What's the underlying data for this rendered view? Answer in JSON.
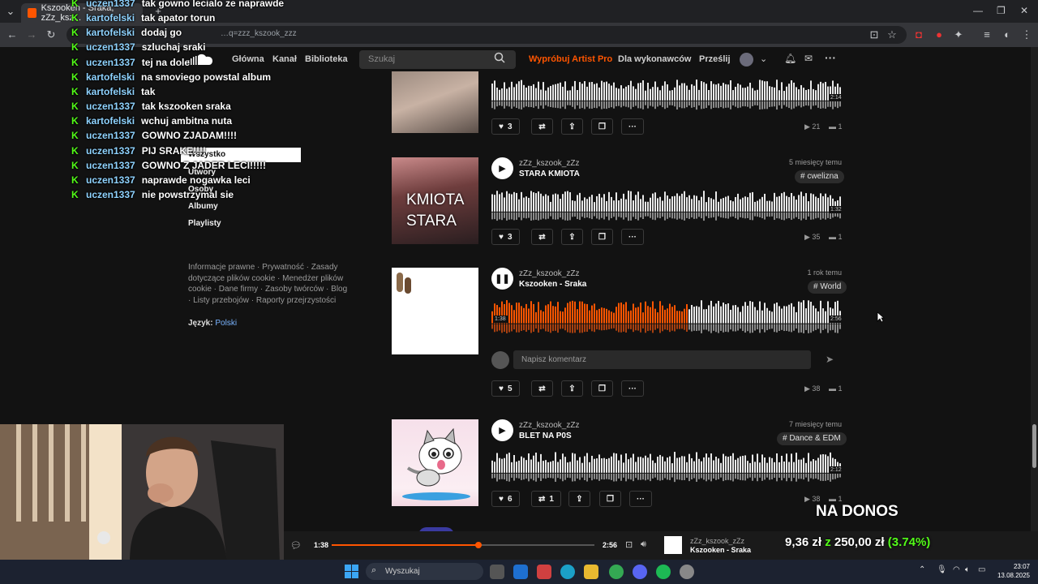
{
  "browser": {
    "tab_title": "Kszooken - Sraka, zZz_ksz...",
    "url": "…q=zzz_kszook_zzz"
  },
  "header": {
    "nav": [
      "Główna",
      "Kanał",
      "Biblioteka"
    ],
    "search_placeholder": "Szukaj",
    "artist_pro": "Wypróbuj Artist Pro",
    "for_artists": "Dla wykonawców",
    "upload": "Prześlij"
  },
  "sidebar": {
    "filters": [
      "Wszystko",
      "Utwory",
      "Osoby",
      "Albumy",
      "Playlisty"
    ],
    "legal": "Informacje prawne · Prywatność · Zasady dotyczące plików cookie · Menedżer plików cookie · Dane firmy · Zasoby twórców · Blog · Listy przebojów · Raporty przejrzystości",
    "lang_label": "Język:",
    "lang_value": "Polski"
  },
  "chat": [
    {
      "user": "uczen1337",
      "msg": "tak gowno lecialo ze naprawde"
    },
    {
      "user": "kartofelski",
      "msg": "tak apator torun"
    },
    {
      "user": "kartofelski",
      "msg": "dodaj go"
    },
    {
      "user": "uczen1337",
      "msg": "szluchaj sraki"
    },
    {
      "user": "uczen1337",
      "msg": "tej na dole"
    },
    {
      "user": "kartofelski",
      "msg": "na smoviego powstal album"
    },
    {
      "user": "kartofelski",
      "msg": "tak"
    },
    {
      "user": "uczen1337",
      "msg": "tak kszooken sraka"
    },
    {
      "user": "kartofelski",
      "msg": "wchuj ambitna nuta"
    },
    {
      "user": "uczen1337",
      "msg": "GOWNO ZJADAM!!!!"
    },
    {
      "user": "uczen1337",
      "msg": "PIJ SRAKE!!!!"
    },
    {
      "user": "uczen1337",
      "msg": "GOWNO Z JADER LECI!!!!!"
    },
    {
      "user": "uczen1337",
      "msg": "naprawde nogawka leci"
    },
    {
      "user": "uczen1337",
      "msg": "nie powstrzymal sie"
    }
  ],
  "tracks": [
    {
      "likes": "3",
      "plays": "21",
      "comments": "1",
      "duration": "2:14"
    },
    {
      "artist": "zZz_kszook_zZz",
      "title": "STARA KMIOTA",
      "ago": "5 miesięcy temu",
      "tag": "# cwelizna",
      "likes": "3",
      "plays": "35",
      "comments": "1",
      "duration": "1:32",
      "art_text": [
        "KMIOTA",
        "STARA"
      ]
    },
    {
      "artist": "zZz_kszook_zZz",
      "title": "Kszooken - Sraka",
      "ago": "1 rok temu",
      "tag": "# World",
      "likes": "5",
      "plays": "38",
      "comments": "1",
      "duration": "2:56",
      "elapsed": "1:38",
      "progress": 0.56,
      "comment_placeholder": "Napisz komentarz"
    },
    {
      "artist": "zZz_kszook_zZz",
      "title": "BLET NA P0S",
      "ago": "7 miesięcy temu",
      "tag": "# Dance & EDM",
      "likes": "6",
      "reposts": "1",
      "plays": "38",
      "comments": "1",
      "duration": "2:12"
    }
  ],
  "player": {
    "elapsed": "1:38",
    "total": "2:56",
    "progress": 0.56,
    "artist": "zZz_kszook_zZz",
    "title": "Kszooken - Sraka"
  },
  "donation": {
    "label": "NA DONOS",
    "current": "9,36 zł",
    "sep": "z",
    "goal": "250,00 zł",
    "percent": "(3.74%)"
  },
  "taskbar": {
    "search": "Wyszukaj",
    "time": "23:07",
    "date": "13.08.2025"
  },
  "colors": {
    "accent": "#ff5500",
    "chat_k": "#53fc18",
    "donation_green": "#53fc18"
  }
}
